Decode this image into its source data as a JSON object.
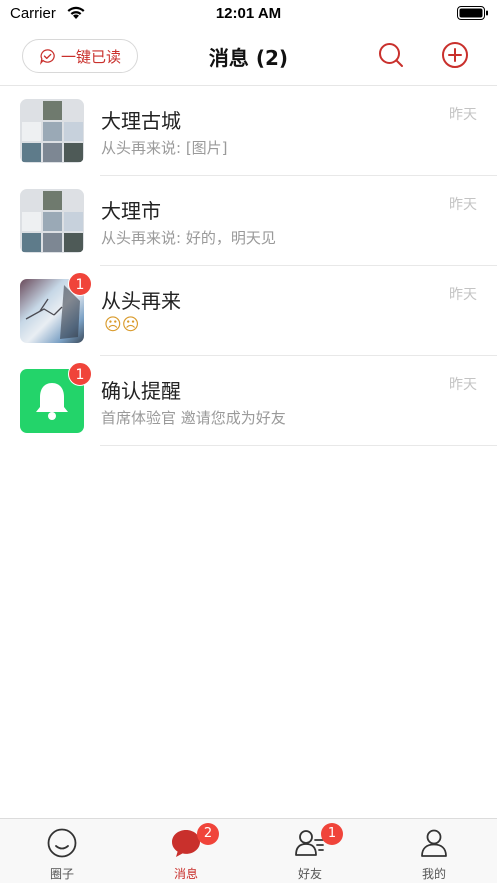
{
  "status_bar": {
    "carrier": "Carrier",
    "time": "12:01 AM"
  },
  "nav": {
    "mark_all_read": "一键已读",
    "title": "消息 (2)",
    "search_icon": "search-icon",
    "add_icon": "plus-circle-icon",
    "accent": "#c9302c"
  },
  "conversations": [
    {
      "title": "大理古城",
      "subtitle": "从头再来说: [图片]",
      "time": "昨天",
      "avatar": "group-collage",
      "badge": null
    },
    {
      "title": "大理市",
      "subtitle": "从头再来说: 好的，明天见",
      "time": "昨天",
      "avatar": "group-collage",
      "badge": null
    },
    {
      "title": "从头再来",
      "subtitle": "☹☹",
      "time": "昨天",
      "avatar": "photo",
      "badge": "1"
    },
    {
      "title": "确认提醒",
      "subtitle": " 首席体验官 邀请您成为好友",
      "time": "昨天",
      "avatar": "bell-icon",
      "badge": "1"
    }
  ],
  "tabbar": {
    "tabs": [
      {
        "label": "圈子",
        "icon": "smile-icon",
        "badge": null
      },
      {
        "label": "消息",
        "icon": "chat-bubble-icon",
        "badge": "2"
      },
      {
        "label": "好友",
        "icon": "friends-icon",
        "badge": "1"
      },
      {
        "label": "我的",
        "icon": "person-icon",
        "badge": null
      }
    ],
    "active_index": 1,
    "active_color": "#c9302c",
    "badge_color": "#f0443a"
  }
}
